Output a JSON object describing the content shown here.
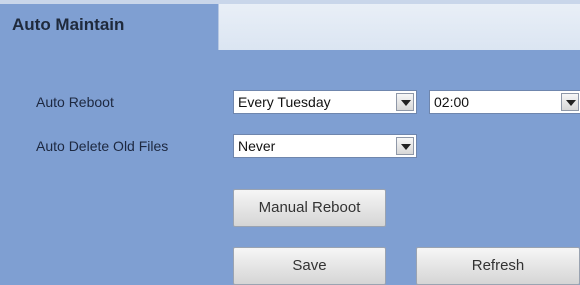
{
  "tab": {
    "title": "Auto Maintain"
  },
  "auto_reboot": {
    "label": "Auto Reboot",
    "day": "Every Tuesday",
    "time": "02:00"
  },
  "auto_delete": {
    "label": "Auto Delete Old Files",
    "value": "Never"
  },
  "buttons": {
    "manual_reboot": "Manual Reboot",
    "save": "Save",
    "refresh": "Refresh"
  }
}
